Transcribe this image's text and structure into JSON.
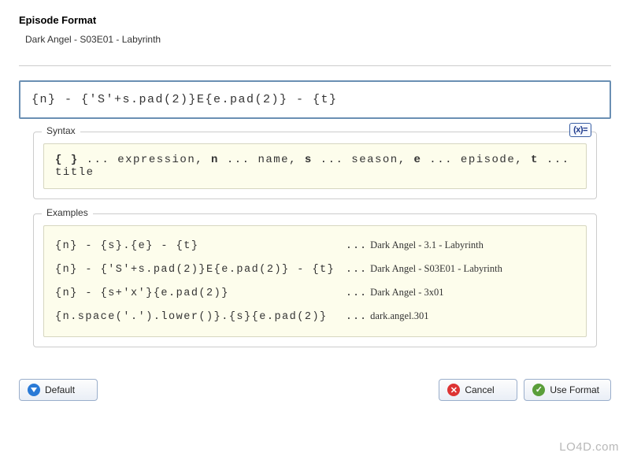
{
  "header": {
    "title": "Episode Format",
    "preview": "Dark Angel - S03E01 - Labyrinth"
  },
  "format_input": "{n} - {'S'+s.pad(2)}E{e.pad(2)} - {t}",
  "syntax": {
    "label": "Syntax",
    "raw_html": "<b>{ }</b> ... expression, <b>n</b> ... name, <b>s</b> ... season, <b>e</b> ... episode, <b>t</b> ... title",
    "badge": "(x)="
  },
  "examples": {
    "label": "Examples",
    "rows": [
      {
        "code": "{n} - {s}.{e} - {t}                   ",
        "out": "Dark Angel - 3.1 - Labyrinth"
      },
      {
        "code": "{n} - {'S'+s.pad(2)}E{e.pad(2)} - {t} ",
        "out": "Dark Angel - S03E01 - Labyrinth"
      },
      {
        "code": "{n} - {s+'x'}{e.pad(2)}               ",
        "out": "Dark Angel - 3x01"
      },
      {
        "code": "{n.space('.').lower()}.{s}{e.pad(2)}  ",
        "out": "dark.angel.301"
      }
    ],
    "dots": "..."
  },
  "buttons": {
    "default": "Default",
    "cancel": "Cancel",
    "use_format": "Use Format"
  },
  "watermark": "LO4D.com"
}
